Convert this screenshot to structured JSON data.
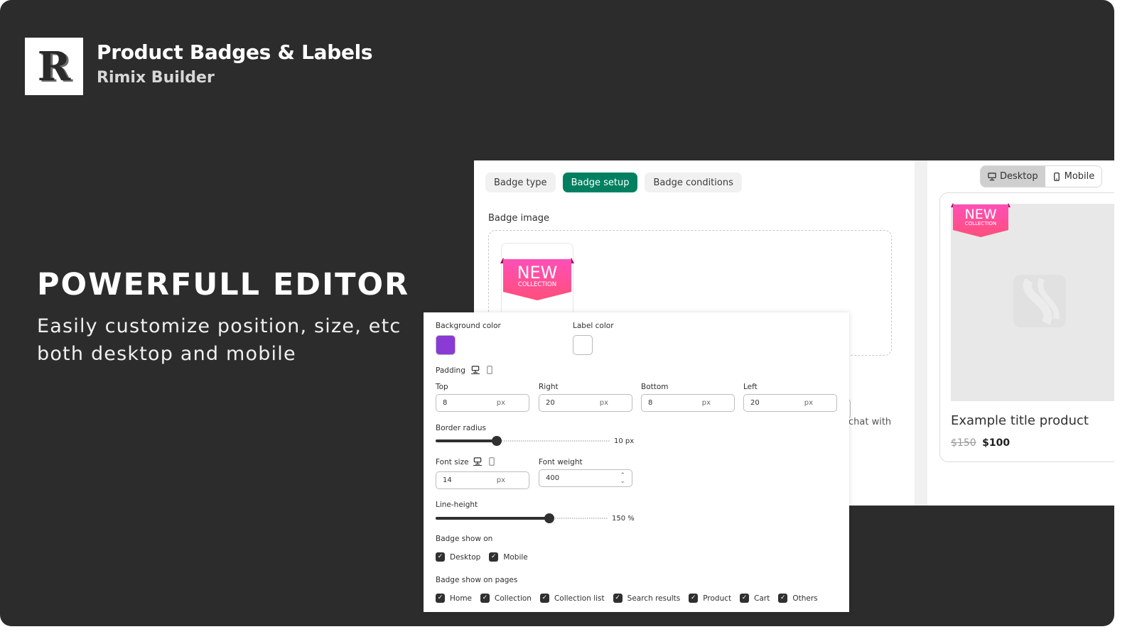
{
  "brand": {
    "logo_letter": "R",
    "title": "Product Badges & Labels",
    "subtitle": "Rimix Builder"
  },
  "hero": {
    "title": "POWERFULL EDITOR",
    "subtitle": "Easily customize position, size, etc both desktop and mobile"
  },
  "editor": {
    "tabs": [
      {
        "label": "Badge type",
        "active": false
      },
      {
        "label": "Badge setup",
        "active": true
      },
      {
        "label": "Badge conditions",
        "active": false
      }
    ],
    "badge_image_label": "Badge image",
    "partial_text": "chat with",
    "accent_color": "#008060"
  },
  "badge": {
    "main_text": "NEW",
    "sub_text": "COLLECTION",
    "gradient_top": "#ff4fb8",
    "gradient_bottom": "#ff4f7a"
  },
  "preview": {
    "device_toggle": [
      {
        "label": "Desktop",
        "icon": "desktop-icon",
        "active": true
      },
      {
        "label": "Mobile",
        "icon": "mobile-icon",
        "active": false
      }
    ],
    "product_title": "Example title product",
    "price_old": "$150",
    "price_new": "$100"
  },
  "settings": {
    "background_color_label": "Background color",
    "background_color": "#8a3bd6",
    "label_color_label": "Label color",
    "label_color": "#ffffff",
    "padding_label": "Padding",
    "padding": [
      {
        "label": "Top",
        "value": "8",
        "unit": "px"
      },
      {
        "label": "Right",
        "value": "20",
        "unit": "px"
      },
      {
        "label": "Bottom",
        "value": "8",
        "unit": "px"
      },
      {
        "label": "Left",
        "value": "20",
        "unit": "px"
      }
    ],
    "border_radius_label": "Border radius",
    "border_radius_value": 10,
    "border_radius_fraction": 0.35,
    "border_radius_display": "10 px",
    "font_size_label": "Font size",
    "font_size_value": "14",
    "font_size_unit": "px",
    "font_weight_label": "Font weight",
    "font_weight_value": "400",
    "line_height_label": "Line-height",
    "line_height_value": 150,
    "line_height_fraction": 0.66,
    "line_height_display": "150 %",
    "show_on_label": "Badge show on",
    "show_on": [
      {
        "label": "Desktop",
        "checked": true
      },
      {
        "label": "Mobile",
        "checked": true
      }
    ],
    "show_on_pages_label": "Badge show on pages",
    "show_on_pages": [
      {
        "label": "Home",
        "checked": true
      },
      {
        "label": "Collection",
        "checked": true
      },
      {
        "label": "Collection list",
        "checked": true
      },
      {
        "label": "Search results",
        "checked": true
      },
      {
        "label": "Product",
        "checked": true
      },
      {
        "label": "Cart",
        "checked": true
      },
      {
        "label": "Others",
        "checked": true
      }
    ]
  }
}
